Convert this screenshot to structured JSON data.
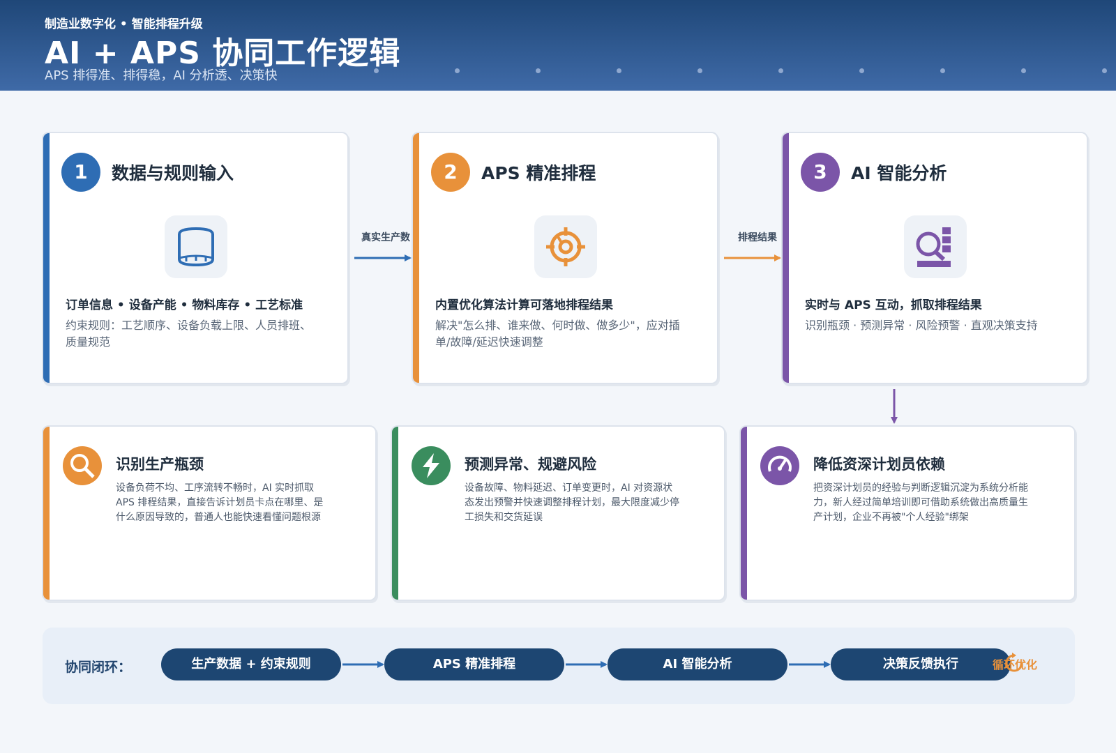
{
  "header": {
    "kicker": "制造业数字化 • 智能排程升级",
    "title": "AI + APS 协同工作逻辑",
    "subtitle": "APS 排得准、排得稳，AI 分析透、决策快"
  },
  "steps": [
    {
      "num": "1",
      "title": "数据与规则输入",
      "icon": "database-icon",
      "subtitle": "订单信息 • 设备产能 • 物料库存 • 工艺标准",
      "desc": "约束规则：工艺顺序、设备负载上限、人员排班、质量规范",
      "color": "#2e6db4"
    },
    {
      "num": "2",
      "title": "APS 精准排程",
      "icon": "target-gear-icon",
      "subtitle": "内置优化算法计算可落地排程结果",
      "desc": "解决\"怎么排、谁来做、何时做、做多少\"，应对插单/故障/延迟快速调整",
      "color": "#e8913a"
    },
    {
      "num": "3",
      "title": "AI 智能分析",
      "icon": "analytics-magnifier-icon",
      "subtitle": "实时与 APS 互动，抓取排程结果",
      "desc": "识别瓶颈 · 预测异常 · 风险预警 · 直观决策支持",
      "color": "#7b55a8"
    }
  ],
  "flow_labels": {
    "step1_to_step2": "真实生产数",
    "step2_to_step3": "排程结果"
  },
  "benefits": [
    {
      "title": "识别生产瓶颈",
      "icon": "search-icon",
      "desc_lines": [
        "设备负荷不均、工序流转不畅时，AI 实时抓取",
        "APS 排程结果，直接告诉计划员卡点在哪里、是",
        "什么原因导致的，普通人也能快速看懂问题根源"
      ],
      "color": "#e8913a"
    },
    {
      "title": "预测异常、规避风险",
      "icon": "lightning-icon",
      "desc_lines": [
        "设备故障、物料延迟、订单变更时，AI 对资源状",
        "态发出预警并快速调整排程计划，最大限度减少停",
        "工损失和交货延误"
      ],
      "color": "#3a8d5e"
    },
    {
      "title": "降低资深计划员依赖",
      "icon": "gauge-icon",
      "desc_lines": [
        "把资深计划员的经验与判断逻辑沉淀为系统分析能",
        "力，新人经过简单培训即可借助系统做出高质量生",
        "产计划，企业不再被\"个人经验\"绑架"
      ],
      "color": "#7b55a8"
    }
  ],
  "loop": {
    "label": "协同闭环：",
    "stages": [
      "生产数据 + 约束规则",
      "APS 精准排程",
      "AI 智能分析",
      "决策反馈执行"
    ],
    "end_label": "循环优化",
    "end_icon": "cycle-icon"
  }
}
